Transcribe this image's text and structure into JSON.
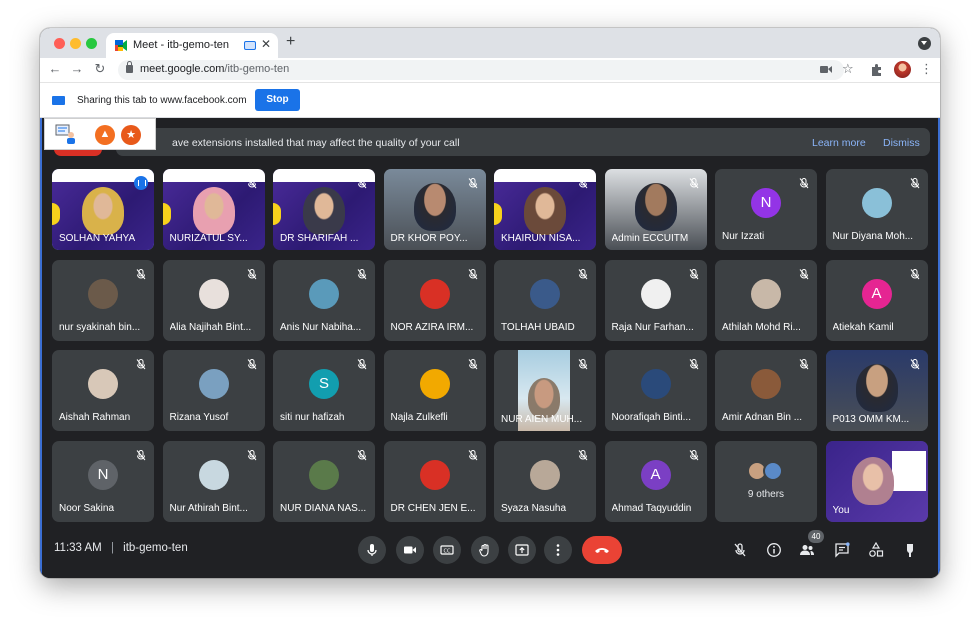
{
  "browser": {
    "tab": {
      "title": "Meet - itb-gemo-ten",
      "close": "✕"
    },
    "new_tab": "+",
    "nav": {
      "back": "←",
      "forward": "→",
      "reload": "↻"
    },
    "url": {
      "host": "meet.google.com",
      "path": "/itb-gemo-ten"
    },
    "star": "☆",
    "menu": "⋮"
  },
  "sharebar": {
    "message": "Sharing this tab to www.facebook.com",
    "stop": "Stop"
  },
  "warning": {
    "text": "ave extensions installed that may affect the quality of your call",
    "learn_more": "Learn more",
    "dismiss": "Dismiss"
  },
  "participants": [
    {
      "name": "SOLHAN YAHYA",
      "kind": "poster",
      "face": "#d9b24a",
      "active": true
    },
    {
      "name": "NURIZATUL SY...",
      "kind": "poster",
      "face": "#e8a0b0"
    },
    {
      "name": "DR SHARIFAH ...",
      "kind": "poster",
      "face": "#3a3a4a"
    },
    {
      "name": "DR KHOR POY...",
      "kind": "photo",
      "bg": "#7a8a9a",
      "face": "#b88a70"
    },
    {
      "name": "KHAIRUN NISA...",
      "kind": "poster",
      "face": "#6b4a3a"
    },
    {
      "name": "Admin ECCUITM",
      "kind": "photo",
      "bg": "#dcdfe2",
      "face": "#a27a5e"
    },
    {
      "name": "Nur Izzati",
      "kind": "avatar",
      "letter": "N",
      "color": "#9334e6"
    },
    {
      "name": "Nur Diyana Moh...",
      "kind": "avatar",
      "letter": "",
      "color": "#8ac0d8"
    },
    {
      "name": "nur syakinah bin...",
      "kind": "avatar",
      "letter": "",
      "color": "#6b5a4a"
    },
    {
      "name": "Alia Najihah Bint...",
      "kind": "avatar",
      "letter": "",
      "color": "#e8e0dc"
    },
    {
      "name": "Anis Nur Nabiha...",
      "kind": "avatar",
      "letter": "",
      "color": "#5a9aba"
    },
    {
      "name": "NOR AZIRA IRM...",
      "kind": "avatar",
      "letter": "",
      "color": "#d93025"
    },
    {
      "name": "TOLHAH UBAID",
      "kind": "avatar",
      "letter": "",
      "color": "#3a5a8a"
    },
    {
      "name": "Raja Nur Farhan...",
      "kind": "avatar",
      "letter": "",
      "color": "#f0f0f0"
    },
    {
      "name": "Athilah Mohd Ri...",
      "kind": "avatar",
      "letter": "",
      "color": "#c8b8a8"
    },
    {
      "name": "Atiekah Kamil",
      "kind": "avatar",
      "letter": "A",
      "color": "#e52592"
    },
    {
      "name": "Aishah Rahman",
      "kind": "avatar",
      "letter": "",
      "color": "#d8c8b8"
    },
    {
      "name": "Rizana Yusof",
      "kind": "avatar",
      "letter": "",
      "color": "#7aa0c0"
    },
    {
      "name": "siti nur hafizah",
      "kind": "avatar",
      "letter": "S",
      "color": "#129eaf"
    },
    {
      "name": "Najla Zulkefli",
      "kind": "avatar",
      "letter": "",
      "color": "#f2a900"
    },
    {
      "name": "NUR AIEN MUH...",
      "kind": "selfie",
      "bg": "#a8cde0",
      "face": "#c89a80"
    },
    {
      "name": "Noorafiqah Binti...",
      "kind": "avatar",
      "letter": "",
      "color": "#2a4a7a"
    },
    {
      "name": "Amir Adnan Bin ...",
      "kind": "avatar",
      "letter": "",
      "color": "#8a5a3a"
    },
    {
      "name": "P013 OMM KM...",
      "kind": "photo",
      "bg": "#2a3a6a",
      "face": "#c8a080"
    },
    {
      "name": "Noor Sakina",
      "kind": "avatar",
      "letter": "N",
      "color": "#5f6368"
    },
    {
      "name": "Nur Athirah Bint...",
      "kind": "avatar",
      "letter": "",
      "color": "#c8d8e0"
    },
    {
      "name": "NUR DIANA NAS...",
      "kind": "avatar",
      "letter": "",
      "color": "#5a7a4a"
    },
    {
      "name": "DR CHEN JEN E...",
      "kind": "avatar",
      "letter": "",
      "color": "#d93025"
    },
    {
      "name": "Syaza Nasuha",
      "kind": "avatar",
      "letter": "",
      "color": "#b8a898"
    },
    {
      "name": "Ahmad Taqyuddin",
      "kind": "avatar",
      "letter": "A",
      "color": "#7b3fc4"
    },
    {
      "name": "9 others",
      "kind": "others"
    },
    {
      "name": "You",
      "kind": "self"
    }
  ],
  "bottom": {
    "time": "11:33 AM",
    "separator": "|",
    "meeting_code": "itb-gemo-ten",
    "people_count": "40"
  },
  "colors": {
    "accent": "#1a73e8",
    "end_call": "#ea4335",
    "tile_bg": "#3c4043",
    "meet_bg": "#202124"
  }
}
